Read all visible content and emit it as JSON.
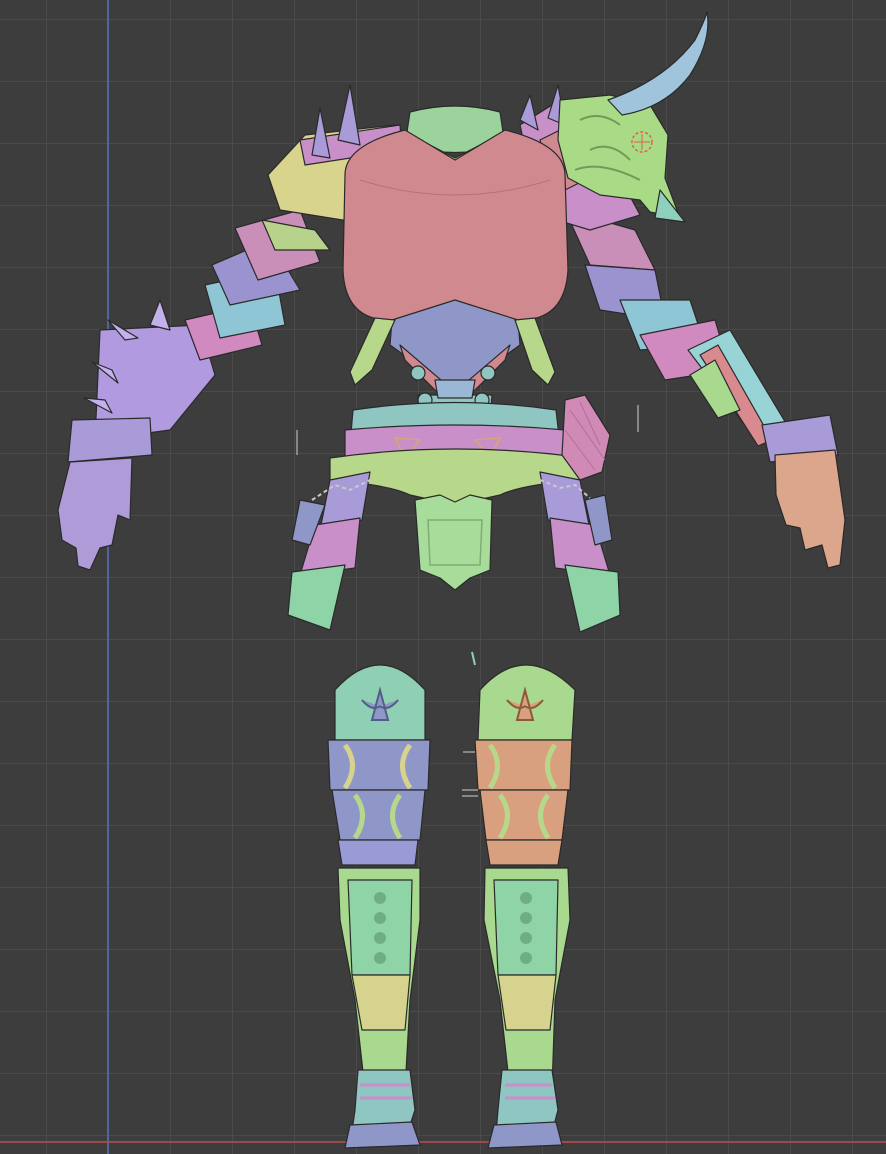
{
  "viewport": {
    "background": "#3d3d3d",
    "grid_color": "#4b4b4b",
    "axis_y_color": "#4f6aa8",
    "axis_x_color": "#a84a4a"
  },
  "model": {
    "subject": "armor-set-polygroup-view",
    "palette": {
      "pink": "#d08a8f",
      "yellow": "#d6d38e",
      "lavender": "#a99ad8",
      "blue": "#8f97c9",
      "green": "#9bd49a",
      "teal": "#8fc6c2",
      "orange": "#d9a07f",
      "magenta": "#c98fc9",
      "horn": "#9fc4dc"
    }
  }
}
